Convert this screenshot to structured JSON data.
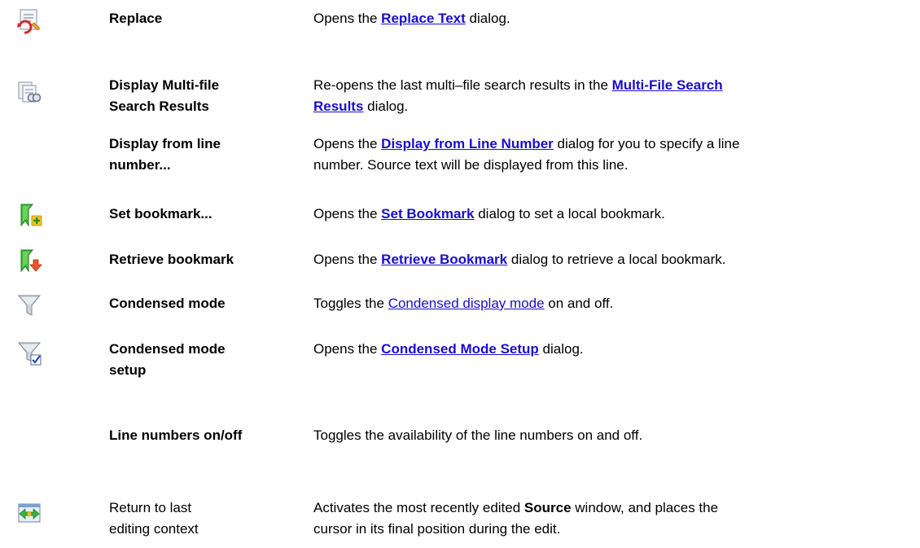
{
  "rows": [
    {
      "label": "Replace",
      "desc_pre": "Opens the ",
      "link": "Replace Text",
      "desc_post": " dialog."
    },
    {
      "label_line1": "Display Multi-file",
      "label_line2": "Search Results",
      "desc_pre": "Re-opens the last multi–file search results in the ",
      "link_part1": "Multi-File Search",
      "link_part2": "Results",
      "desc_post": " dialog."
    },
    {
      "label_line1": "Display from line",
      "label_line2": "number...",
      "desc_pre": "Opens the ",
      "link": "Display from Line Number",
      "desc_post": " dialog for you to specify a line",
      "desc_line2": "number. Source text will be displayed from this line."
    },
    {
      "label": "Set bookmark...",
      "desc_pre": "Opens the ",
      "link": "Set Bookmark",
      "desc_post": " dialog  to set a local bookmark."
    },
    {
      "label": "Retrieve bookmark",
      "desc_pre": "Opens the ",
      "link": "Retrieve Bookmark",
      "desc_post": " dialog to retrieve a local bookmark."
    },
    {
      "label": "Condensed mode",
      "desc_pre": "Toggles the ",
      "link": "Condensed display mode",
      "desc_post": " on and off."
    },
    {
      "label_line1": "Condensed mode",
      "label_line2": "setup",
      "desc_pre": "Opens the ",
      "link": "Condensed Mode Setup",
      "desc_post": " dialog."
    },
    {
      "label": "Line numbers on/off",
      "desc": "Toggles the availability of the line numbers on and off."
    },
    {
      "label_line1": "Return to last",
      "label_line2": "editing context",
      "desc_pre": " Activates the most recently edited ",
      "bold": "Source",
      "desc_post": " window, and places the",
      "desc_line2": "cursor in its final position during the edit."
    }
  ],
  "icons": {
    "replace": "replace-icon",
    "multi_file": "multi-file-search-results-icon",
    "set_bookmark": "set-bookmark-icon",
    "retrieve_bookmark": "retrieve-bookmark-icon",
    "condensed": "funnel-icon",
    "condensed_setup": "funnel-check-icon",
    "return": "return-to-editing-context-icon"
  }
}
